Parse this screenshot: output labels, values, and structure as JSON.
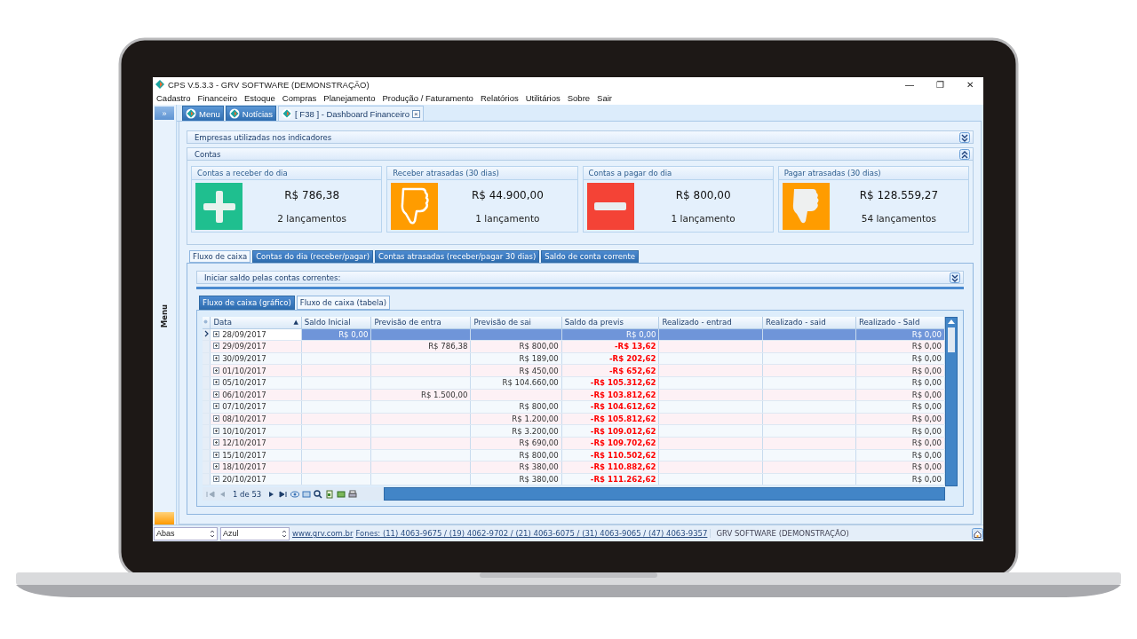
{
  "window": {
    "title": "CPS V.5.3.3 - GRV SOFTWARE (DEMONSTRAÇÃO)",
    "controls": [
      "—",
      "❐",
      "✕"
    ]
  },
  "menu": [
    "Cadastro",
    "Financeiro",
    "Estoque",
    "Compras",
    "Planejamento",
    "Produção / Faturamento",
    "Relatórios",
    "Utilitários",
    "Sobre",
    "Sair"
  ],
  "sidebar": {
    "toggle": "»",
    "label": "Menu"
  },
  "doc_tabs": [
    {
      "label": "Menu",
      "kind": "button"
    },
    {
      "label": "Notícias",
      "kind": "button"
    },
    {
      "label": "[ F38 ] - Dashboard Financeiro",
      "kind": "document",
      "selected": true,
      "close": "×"
    }
  ],
  "sections": [
    {
      "title": "Empresas utilizadas nos indicadores",
      "expanded": false
    },
    {
      "title": "Contas",
      "expanded": true
    }
  ],
  "cards": [
    {
      "title": "Contas a receber do dia",
      "amount": "R$ 786,38",
      "count": "2 lançamentos",
      "kind": "plus",
      "color": "#1fbf8f"
    },
    {
      "title": "Receber atrasadas (30 dias)",
      "amount": "R$ 44.900,00",
      "count": "1 lançamento",
      "kind": "thumbs-down-outline",
      "color": "#ff9c00"
    },
    {
      "title": "Contas a pagar do dia",
      "amount": "R$ 800,00",
      "count": "1 lançamento",
      "kind": "minus",
      "color": "#f44336"
    },
    {
      "title": "Pagar atrasadas (30 dias)",
      "amount": "R$ 128.559,27",
      "count": "54 lançamentos",
      "kind": "thumbs-down",
      "color": "#ff9c00"
    }
  ],
  "view_tabs": [
    {
      "label": "Fluxo de caixa",
      "selected": true
    },
    {
      "label": "Contas do dia (receber/pagar)",
      "selected": false
    },
    {
      "label": "Contas atrasadas (receber/pagar 30 dias)",
      "selected": false
    },
    {
      "label": "Saldo de conta corrente",
      "selected": false
    }
  ],
  "balance_bar": {
    "title": "Iniciar saldo pelas contas correntes:",
    "expanded": false
  },
  "sub_tabs": [
    {
      "label": "Fluxo de caixa (gráfico)",
      "selected": false
    },
    {
      "label": "Fluxo de caixa (tabela)",
      "selected": true
    }
  ],
  "table": {
    "columns": [
      "Data",
      "Saldo Inicial",
      "Previsão de entra",
      "Previsão de sai",
      "Saldo da previs",
      "Realizado - entrad",
      "Realizado - said",
      "Realizado - Sald"
    ],
    "sort_mark": "▲",
    "rows": [
      {
        "selected": true,
        "negative": false,
        "cells": [
          "28/09/2017",
          "R$ 0,00",
          null,
          null,
          "R$ 0,00",
          null,
          null,
          "R$ 0,00"
        ]
      },
      {
        "selected": false,
        "negative": true,
        "cells": [
          "29/09/2017",
          null,
          "R$ 786,38",
          "R$ 800,00",
          "-R$ 13,62",
          null,
          null,
          "R$ 0,00"
        ]
      },
      {
        "selected": false,
        "negative": true,
        "cells": [
          "30/09/2017",
          null,
          null,
          "R$ 189,00",
          "-R$ 202,62",
          null,
          null,
          "R$ 0,00"
        ]
      },
      {
        "selected": false,
        "negative": true,
        "cells": [
          "01/10/2017",
          null,
          null,
          "R$ 450,00",
          "-R$ 652,62",
          null,
          null,
          "R$ 0,00"
        ]
      },
      {
        "selected": false,
        "negative": true,
        "cells": [
          "05/10/2017",
          null,
          null,
          "R$ 104.660,00",
          "-R$ 105.312,62",
          null,
          null,
          "R$ 0,00"
        ]
      },
      {
        "selected": false,
        "negative": true,
        "cells": [
          "06/10/2017",
          null,
          "R$ 1.500,00",
          null,
          "-R$ 103.812,62",
          null,
          null,
          "R$ 0,00"
        ]
      },
      {
        "selected": false,
        "negative": true,
        "cells": [
          "07/10/2017",
          null,
          null,
          "R$ 800,00",
          "-R$ 104.612,62",
          null,
          null,
          "R$ 0,00"
        ]
      },
      {
        "selected": false,
        "negative": true,
        "cells": [
          "08/10/2017",
          null,
          null,
          "R$ 1.200,00",
          "-R$ 105.812,62",
          null,
          null,
          "R$ 0,00"
        ]
      },
      {
        "selected": false,
        "negative": true,
        "cells": [
          "10/10/2017",
          null,
          null,
          "R$ 3.200,00",
          "-R$ 109.012,62",
          null,
          null,
          "R$ 0,00"
        ]
      },
      {
        "selected": false,
        "negative": true,
        "cells": [
          "12/10/2017",
          null,
          null,
          "R$ 690,00",
          "-R$ 109.702,62",
          null,
          null,
          "R$ 0,00"
        ]
      },
      {
        "selected": false,
        "negative": true,
        "cells": [
          "15/10/2017",
          null,
          null,
          "R$ 800,00",
          "-R$ 110.502,62",
          null,
          null,
          "R$ 0,00"
        ]
      },
      {
        "selected": false,
        "negative": true,
        "cells": [
          "18/10/2017",
          null,
          null,
          "R$ 380,00",
          "-R$ 110.882,62",
          null,
          null,
          "R$ 0,00"
        ]
      },
      {
        "selected": false,
        "negative": true,
        "cells": [
          "20/10/2017",
          null,
          null,
          "R$ 380,00",
          "-R$ 111.262,62",
          null,
          null,
          "R$ 0,00"
        ]
      }
    ],
    "pager": "1 de 53"
  },
  "status_bar": {
    "tab_mode": "Abas",
    "theme": "Azul",
    "site": "www.grv.com.br",
    "phones": "Fones: (11) 4063-9675 / (19) 4062-9702 / (21) 4063-6075 / (31) 4063-9065 / (47) 4063-9357",
    "company": "GRV SOFTWARE (DEMONSTRAÇÃO)"
  }
}
